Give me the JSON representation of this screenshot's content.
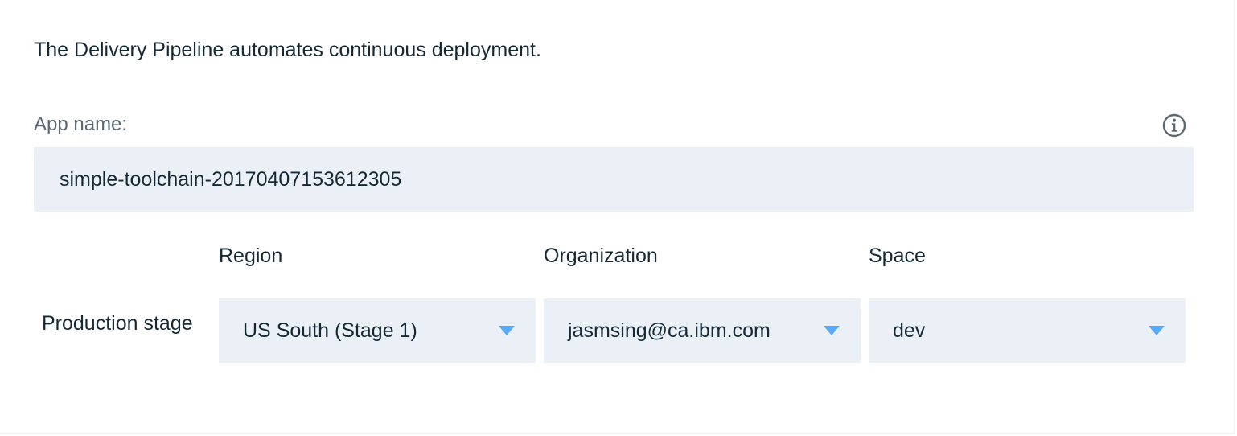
{
  "description": "The Delivery Pipeline automates continuous deployment.",
  "app_name": {
    "label": "App name:",
    "value": "simple-toolchain-20170407153612305",
    "info_icon": "info-icon"
  },
  "stage": {
    "label": "Production stage",
    "columns": {
      "region": "Region",
      "organization": "Organization",
      "space": "Space"
    },
    "values": {
      "region": "US South (Stage 1)",
      "organization": "jasmsing@ca.ibm.com",
      "space": "dev"
    },
    "caret_icon": "chevron-down-icon",
    "caret_color": "#5aaafa"
  },
  "colors": {
    "field_background": "#ebf0f7",
    "text": "#152935",
    "label": "#5a6872"
  }
}
